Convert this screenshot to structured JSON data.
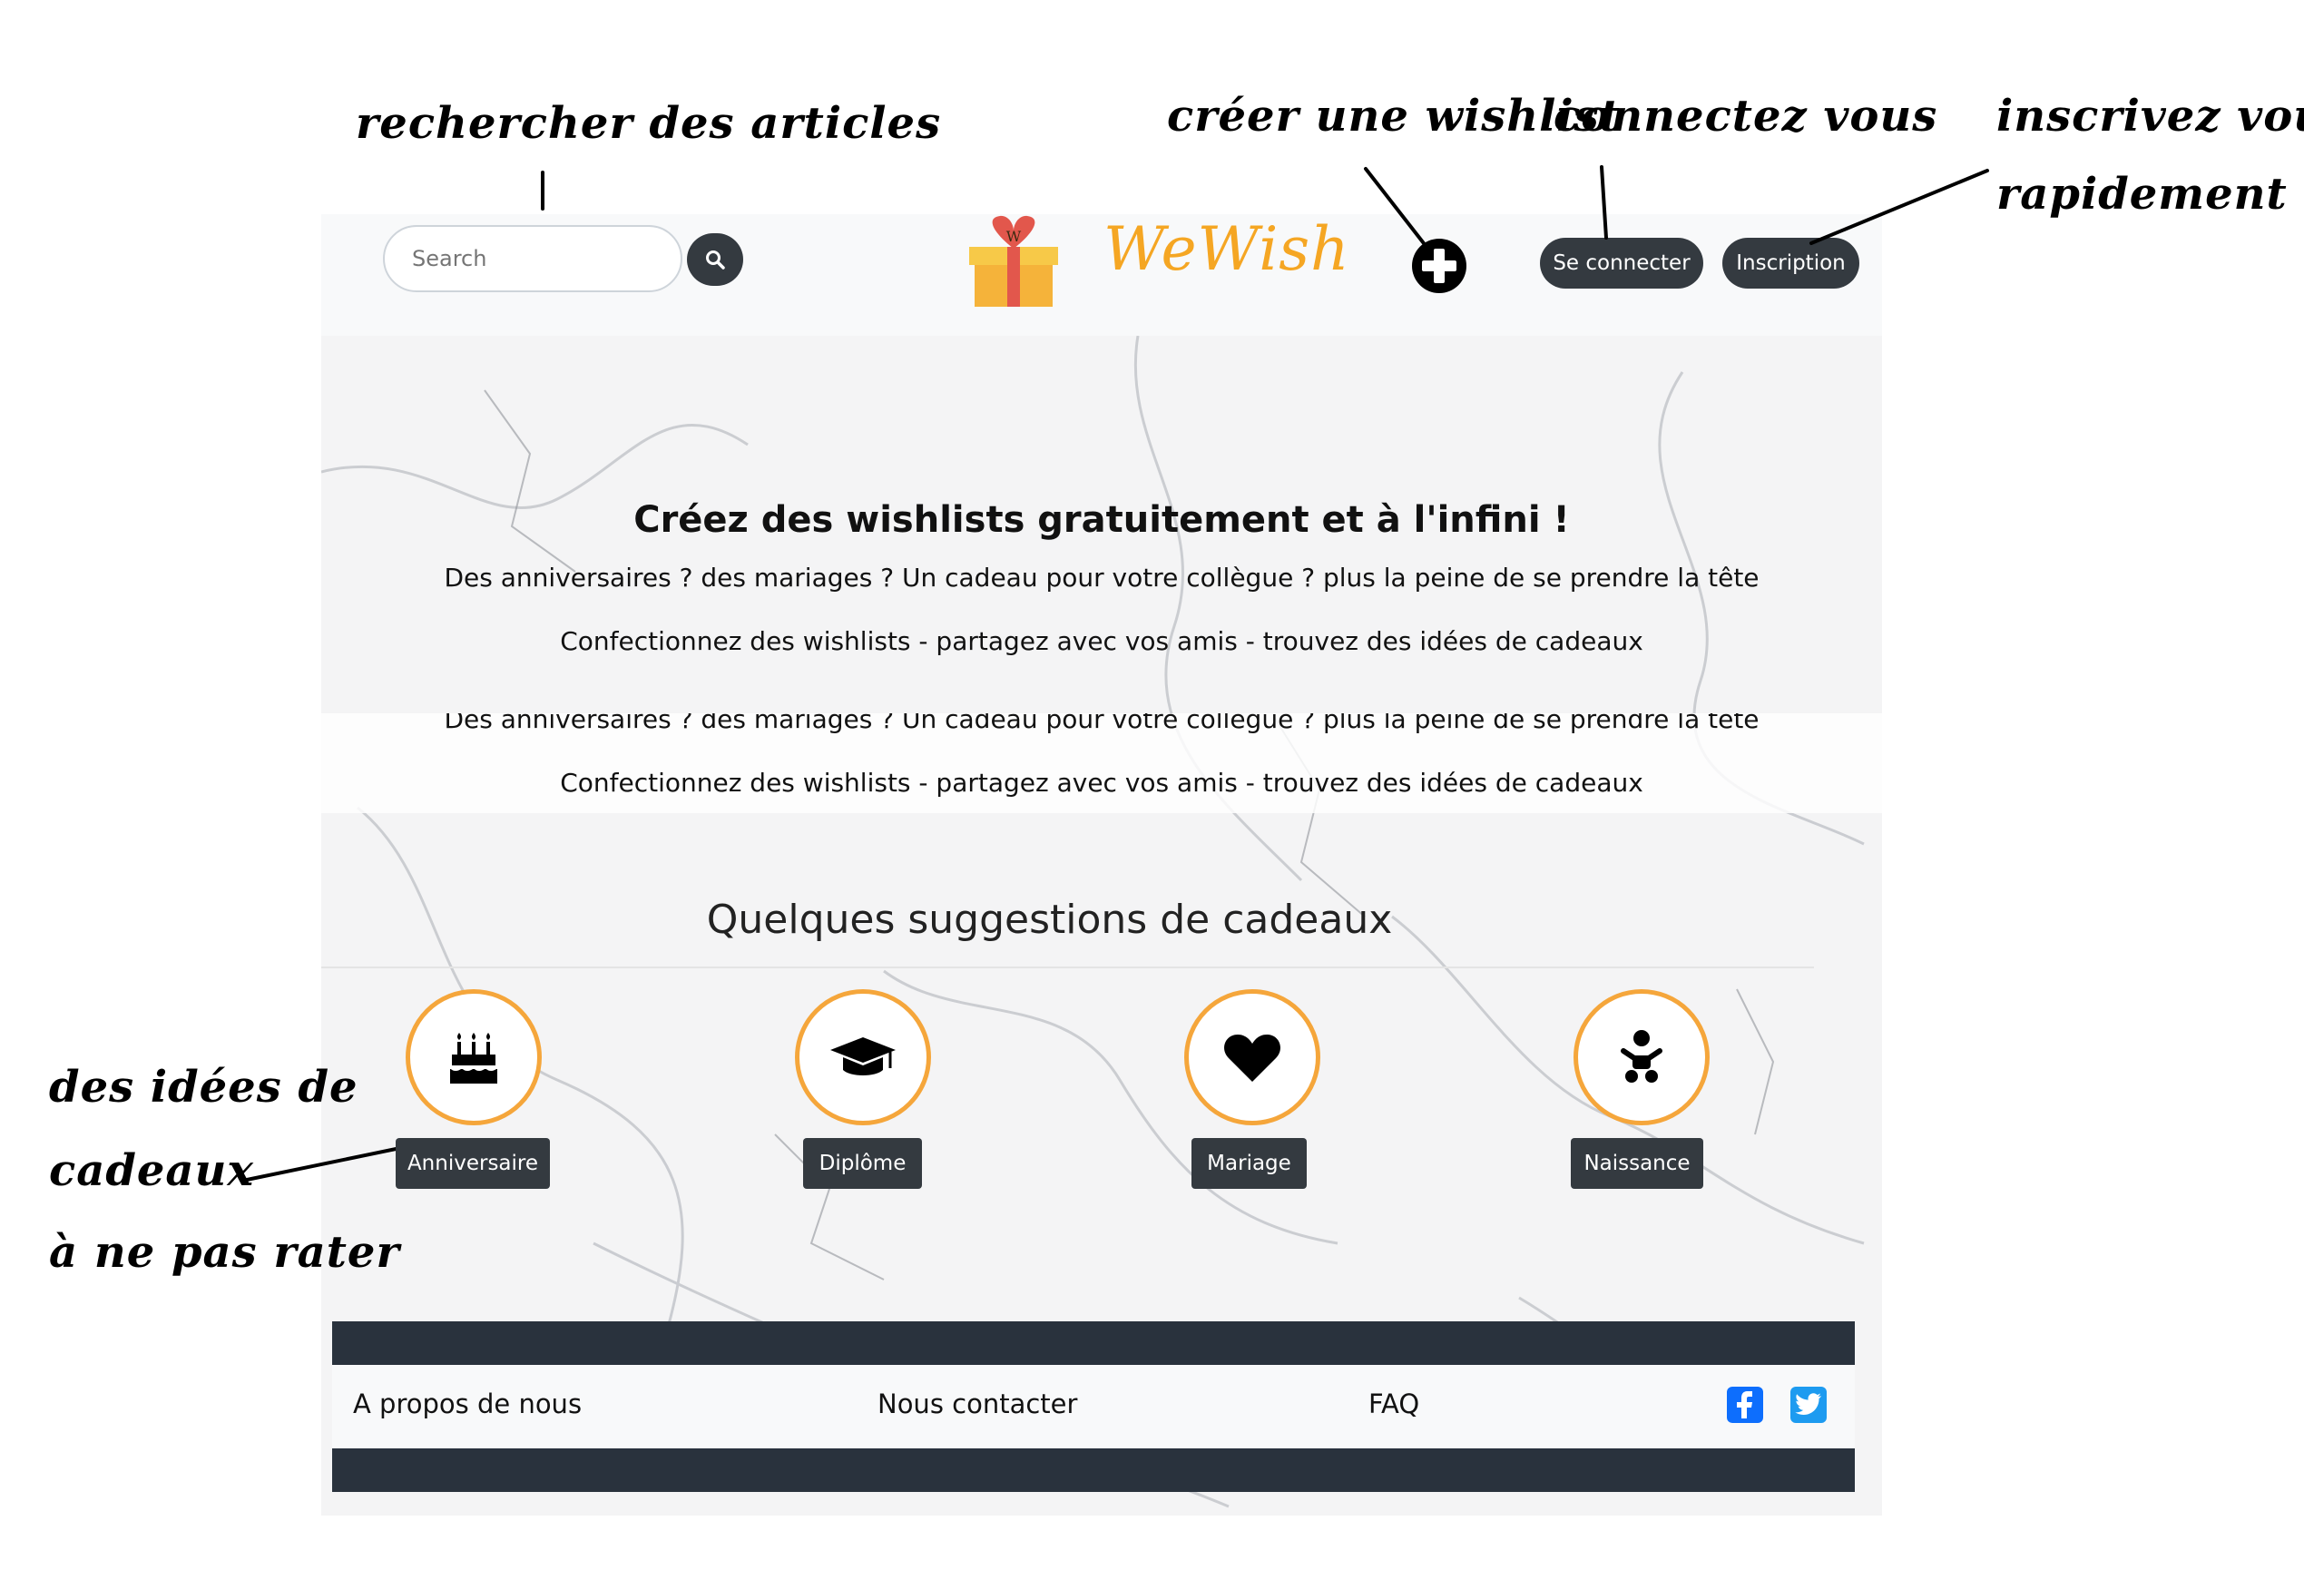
{
  "annotations": {
    "search": "rechercher des articles",
    "create_wishlist": "créer une wishlist",
    "login": "connectez vous",
    "signup_line1": "inscrivez vous",
    "signup_line2": "rapidement",
    "gifts_line1": "des idées de",
    "gifts_line2": "cadeaux",
    "gifts_line3": "à ne pas rater"
  },
  "navbar": {
    "search_placeholder": "Search",
    "brand": "WeWish",
    "logo_letter": "W",
    "login_label": "Se connecter",
    "signup_label": "Inscription"
  },
  "hero": {
    "title": "Créez des wishlists gratuitement et à l'infini !",
    "line1": "Des anniversaires ? des mariages ? Un cadeau pour votre collègue ? plus la peine de se prendre la tête",
    "line2": "Confectionnez des wishlists - partagez avec vos amis - trouvez des idées de cadeaux",
    "line1_repeat": "Des anniversaires ? des mariages ? Un cadeau pour votre collègue ? plus la peine de se prendre la tête",
    "line2_repeat": "Confectionnez des wishlists - partagez avec vos amis - trouvez des idées de cadeaux"
  },
  "suggestions": {
    "title": "Quelques suggestions de cadeaux",
    "categories": [
      {
        "label": "Anniversaire",
        "icon": "birthday-cake-icon"
      },
      {
        "label": "Diplôme",
        "icon": "graduation-cap-icon"
      },
      {
        "label": "Mariage",
        "icon": "heart-icon"
      },
      {
        "label": "Naissance",
        "icon": "baby-icon"
      }
    ]
  },
  "footer": {
    "about": "A propos de nous",
    "contact": "Nous contacter",
    "faq": "FAQ",
    "social": [
      "facebook-icon",
      "twitter-icon"
    ]
  },
  "colors": {
    "accent": "#f5a63b",
    "dark": "#343a40",
    "footer_dark": "#29323d",
    "facebook": "#0d6efd"
  }
}
